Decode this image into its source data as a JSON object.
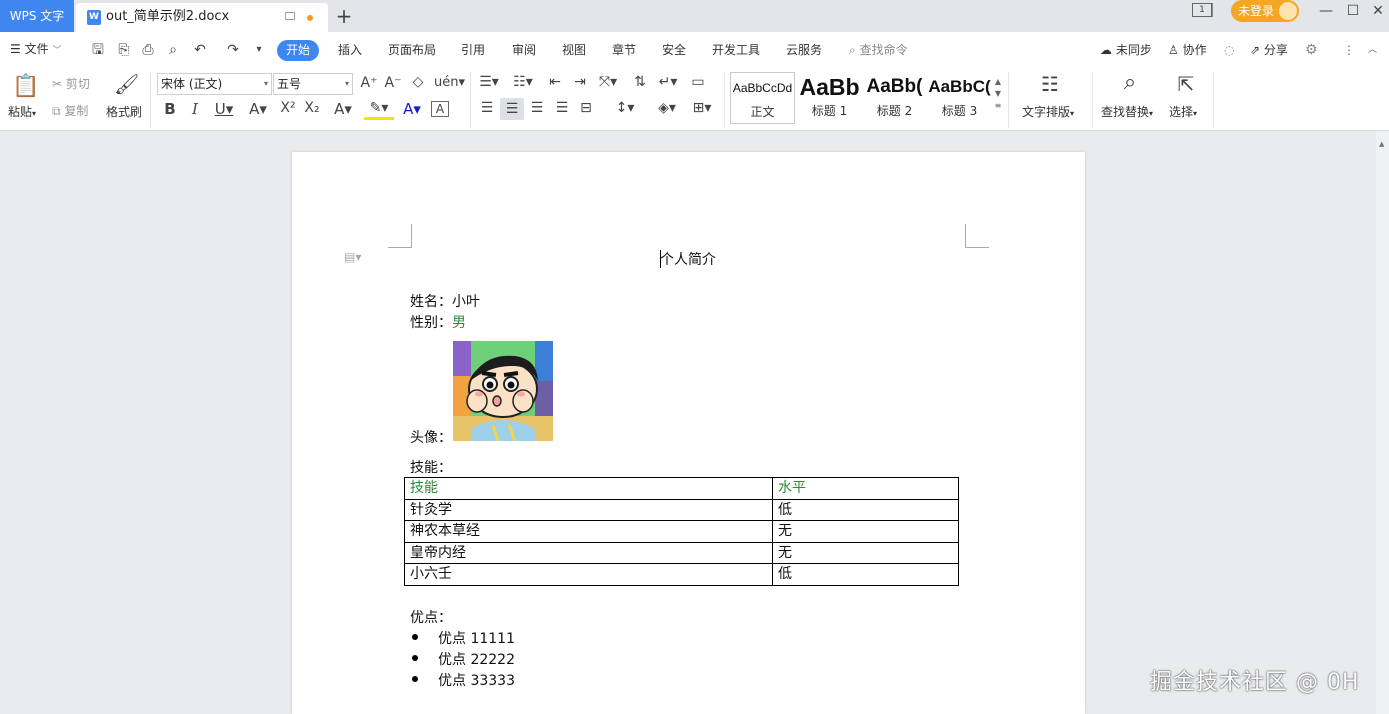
{
  "titlebar": {
    "app_name": "WPS 文字",
    "doc_tab": "out_简单示例2.docx",
    "layout_indicator": "1",
    "login": "未登录"
  },
  "menubar": {
    "file": "文件",
    "tabs": [
      "开始",
      "插入",
      "页面布局",
      "引用",
      "审阅",
      "视图",
      "章节",
      "安全",
      "开发工具",
      "云服务"
    ],
    "search_cmd": "查找命令",
    "sync": "未同步",
    "collab": "协作",
    "share": "分享"
  },
  "ribbon": {
    "paste": "粘贴",
    "cut": "剪切",
    "copy": "复制",
    "format_painter": "格式刷",
    "font_name": "宋体 (正文)",
    "font_size": "五号",
    "styles": [
      {
        "preview": "AaBbCcDd",
        "label": "正文"
      },
      {
        "preview": "AaBb",
        "label": "标题 1"
      },
      {
        "preview": "AaBb(",
        "label": "标题 2"
      },
      {
        "preview": "AaBbC(",
        "label": "标题 3"
      }
    ],
    "text_layout": "文字排版",
    "find_replace": "查找替换",
    "select": "选择"
  },
  "document": {
    "title": "个人简介",
    "name_label": "姓名：",
    "name_value": "小叶",
    "gender_label": "性别：",
    "gender_value": "男",
    "avatar_label": "头像：",
    "skills_label": "技能：",
    "skills_table": {
      "headers": [
        "技能",
        "水平"
      ],
      "rows": [
        [
          "针灸学",
          "低"
        ],
        [
          "神农本草经",
          "无"
        ],
        [
          "皇帝内经",
          "无"
        ],
        [
          "小六壬",
          "低"
        ]
      ]
    },
    "merits_label": "优点：",
    "merits": [
      "优点 11111",
      "优点 22222",
      "优点 33333"
    ]
  },
  "watermark": "掘金技术社区 @ 0H",
  "colors": {
    "accent": "#3f86f0",
    "login": "#f5a623",
    "green_text": "#2e8b3a"
  }
}
